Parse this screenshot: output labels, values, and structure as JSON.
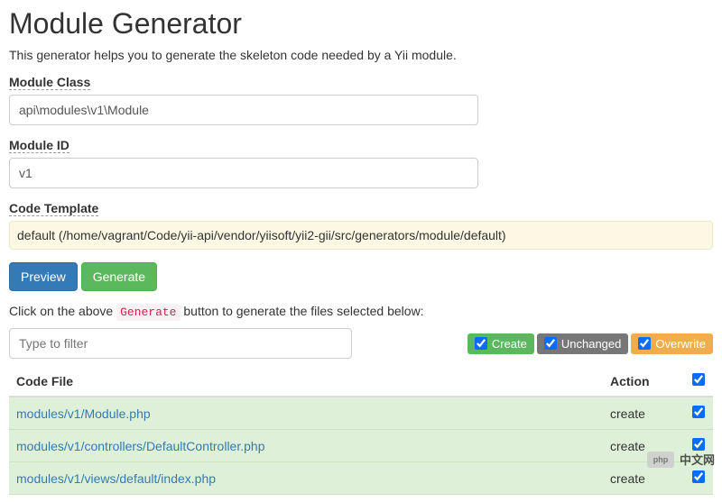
{
  "title": "Module Generator",
  "description": "This generator helps you to generate the skeleton code needed by a Yii module.",
  "form": {
    "moduleClass": {
      "label": "Module Class",
      "value": "api\\modules\\v1\\Module"
    },
    "moduleId": {
      "label": "Module ID",
      "value": "v1"
    },
    "codeTemplate": {
      "label": "Code Template",
      "value": "default (/home/vagrant/Code/yii-api/vendor/yiisoft/yii2-gii/src/generators/module/default)"
    }
  },
  "buttons": {
    "preview": "Preview",
    "generate": "Generate"
  },
  "hint": {
    "prefix": "Click on the above ",
    "code": "Generate",
    "suffix": " button to generate the files selected below:"
  },
  "filter": {
    "placeholder": "Type to filter"
  },
  "legend": {
    "create": "Create",
    "unchanged": "Unchanged",
    "overwrite": "Overwrite"
  },
  "table": {
    "headers": {
      "file": "Code File",
      "action": "Action"
    },
    "rows": [
      {
        "file": "modules/v1/Module.php",
        "action": "create",
        "checked": true
      },
      {
        "file": "modules/v1/controllers/DefaultController.php",
        "action": "create",
        "checked": true
      },
      {
        "file": "modules/v1/views/default/index.php",
        "action": "create",
        "checked": true
      }
    ],
    "selectAll": true
  },
  "watermark": {
    "logo": "php",
    "text": "中文网"
  }
}
